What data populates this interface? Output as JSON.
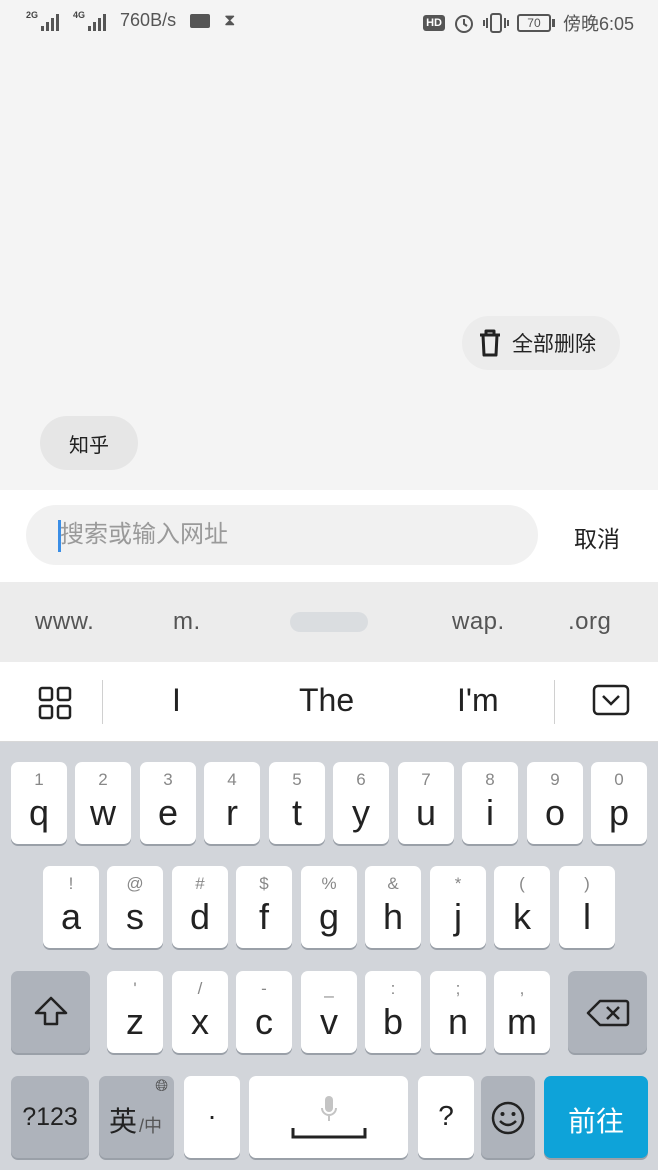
{
  "status_bar": {
    "sim1_tag": "2G",
    "sim2_tag": "4G",
    "speed": "760B/s",
    "hd": "HD",
    "battery": "70",
    "time": "傍晚6:05"
  },
  "content": {
    "delete_all_label": "全部删除",
    "history_chip": "知乎"
  },
  "search": {
    "placeholder": "搜索或输入网址",
    "cancel_label": "取消"
  },
  "url_shortcuts": [
    "www.",
    "m.",
    "wap.",
    ".org"
  ],
  "suggestions": [
    "I",
    "The",
    "I'm"
  ],
  "keyboard": {
    "row1": [
      {
        "sub": "1",
        "main": "q"
      },
      {
        "sub": "2",
        "main": "w"
      },
      {
        "sub": "3",
        "main": "e"
      },
      {
        "sub": "4",
        "main": "r"
      },
      {
        "sub": "5",
        "main": "t"
      },
      {
        "sub": "6",
        "main": "y"
      },
      {
        "sub": "7",
        "main": "u"
      },
      {
        "sub": "8",
        "main": "i"
      },
      {
        "sub": "9",
        "main": "o"
      },
      {
        "sub": "0",
        "main": "p"
      }
    ],
    "row2": [
      {
        "sub": "!",
        "main": "a"
      },
      {
        "sub": "@",
        "main": "s"
      },
      {
        "sub": "#",
        "main": "d"
      },
      {
        "sub": "$",
        "main": "f"
      },
      {
        "sub": "%",
        "main": "g"
      },
      {
        "sub": "&",
        "main": "h"
      },
      {
        "sub": "*",
        "main": "j"
      },
      {
        "sub": "(",
        "main": "k"
      },
      {
        "sub": ")",
        "main": "l"
      }
    ],
    "row3": [
      {
        "sub": "'",
        "main": "z"
      },
      {
        "sub": "/",
        "main": "x"
      },
      {
        "sub": "-",
        "main": "c"
      },
      {
        "sub": "_",
        "main": "v"
      },
      {
        "sub": ":",
        "main": "b"
      },
      {
        "sub": ";",
        "main": "n"
      },
      {
        "sub": ",",
        "main": "m"
      }
    ],
    "num_label": "?123",
    "lang_main": "英",
    "lang_sub": "/中",
    "dot_label": "·",
    "question_label": "?",
    "go_label": "前往",
    "go_color": "#0ea3d9"
  }
}
